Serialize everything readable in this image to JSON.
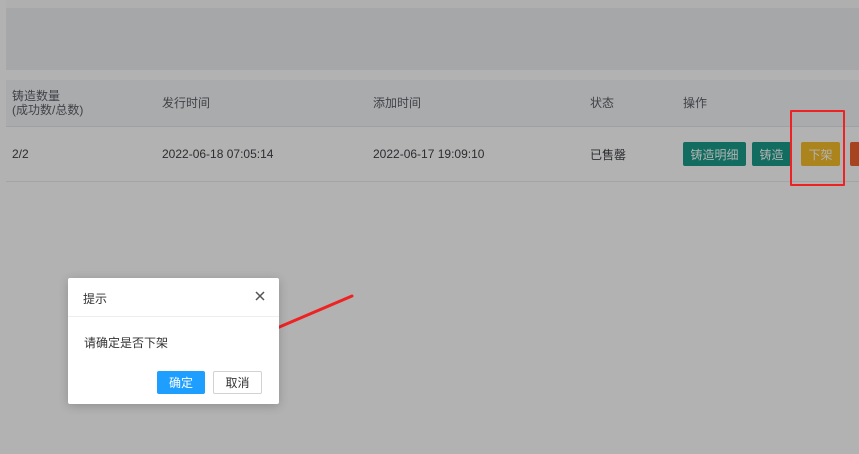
{
  "table": {
    "headers": {
      "quantity_line1": "铸造数量",
      "quantity_line2": "(成功数/总数)",
      "issue_time": "发行时间",
      "add_time": "添加时间",
      "status": "状态",
      "actions": "操作"
    },
    "row": {
      "quantity": "2/2",
      "issue_time": "2022-06-18 07:05:14",
      "add_time": "2022-06-17 19:09:10",
      "status": "已售罄",
      "btn_detail": "铸造明细",
      "btn_mint": "铸造",
      "btn_delist": "下架"
    }
  },
  "dialog": {
    "title": "提示",
    "message": "请确定是否下架",
    "ok_label": "确定",
    "cancel_label": "取消",
    "close_icon": "close-icon"
  },
  "colors": {
    "teal": "#1a9b8a",
    "yellow": "#f6be2c",
    "red": "#f0622f",
    "primary": "#1e9fff",
    "annotation": "#ee2222"
  }
}
